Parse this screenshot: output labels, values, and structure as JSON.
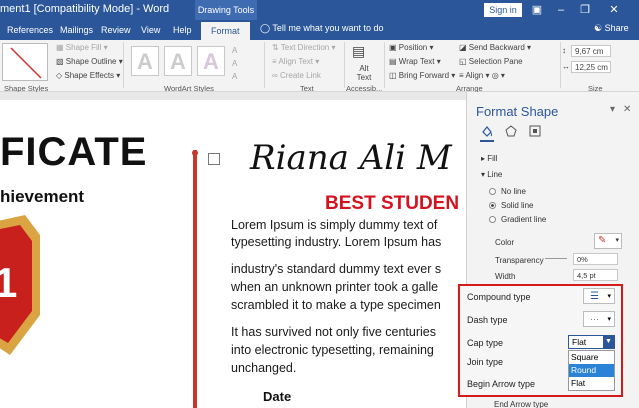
{
  "window": {
    "title": "ment1 [Compatibility Mode] - Word",
    "contextual_group": "Drawing Tools",
    "sign_in": "Sign in"
  },
  "tabs": [
    "References",
    "Mailings",
    "Review",
    "View",
    "Help",
    "Format"
  ],
  "active_tab": "Format",
  "tell_me": "Tell me what you want to do",
  "share": "Share",
  "ribbon": {
    "shape_fill": "Shape Fill",
    "shape_outline": "Shape Outline",
    "shape_effects": "Shape Effects",
    "shape_styles_label": "Shape Styles",
    "wordart_letters": [
      "A",
      "A",
      "A"
    ],
    "wordart_label": "WordArt Styles",
    "text_direction": "Text Direction",
    "align_text": "Align Text",
    "create_link": "Create Link",
    "text_label": "Text",
    "alt_text": "Alt Text",
    "accessibility_label": "Accessib...",
    "position": "Position",
    "wrap_text": "Wrap Text",
    "bring_forward": "Bring Forward",
    "send_backward": "Send Backward",
    "selection_pane": "Selection Pane",
    "align": "Align",
    "arrange_label": "Arrange",
    "height": "9,67 cm",
    "width": "12,25 cm",
    "size_label": "Size"
  },
  "document": {
    "title_fragment": "FICATE",
    "subtitle_fragment": "hievement",
    "badge_number": "1",
    "signature": "Riana Ali M",
    "heading": "BEST STUDEN",
    "paragraph_lines": [
      "Lorem Ipsum is simply dummy text of",
      "typesetting industry. Lorem Ipsum has",
      "industry's standard dummy text ever s",
      "when an unknown printer took a galle",
      "scrambled it to make a type specimen",
      " It has survived not only five centuries",
      "into electronic typesetting, remaining",
      "unchanged."
    ],
    "date_label": "Date"
  },
  "format_pane": {
    "title": "Format Shape",
    "fill": "Fill",
    "line": "Line",
    "no_line": "No line",
    "solid_line": "Solid line",
    "gradient_line": "Gradient line",
    "color": "Color",
    "transparency": "Transparency",
    "transparency_value": "0%",
    "width": "Width",
    "width_value": "4,5 pt",
    "compound_type": "Compound type",
    "dash_type": "Dash type",
    "cap_type": "Cap type",
    "cap_value": "Flat",
    "cap_options": [
      "Square",
      "Round",
      "Flat"
    ],
    "cap_highlighted": "Round",
    "join_type": "Join type",
    "begin_arrow_type": "Begin Arrow type",
    "end_arrow_type": "End Arrow type"
  },
  "colors": {
    "brand": "#2b579a",
    "highlight_border": "#d51a1a",
    "heading_red": "#d3131f",
    "accent_line": "#c8372d"
  }
}
